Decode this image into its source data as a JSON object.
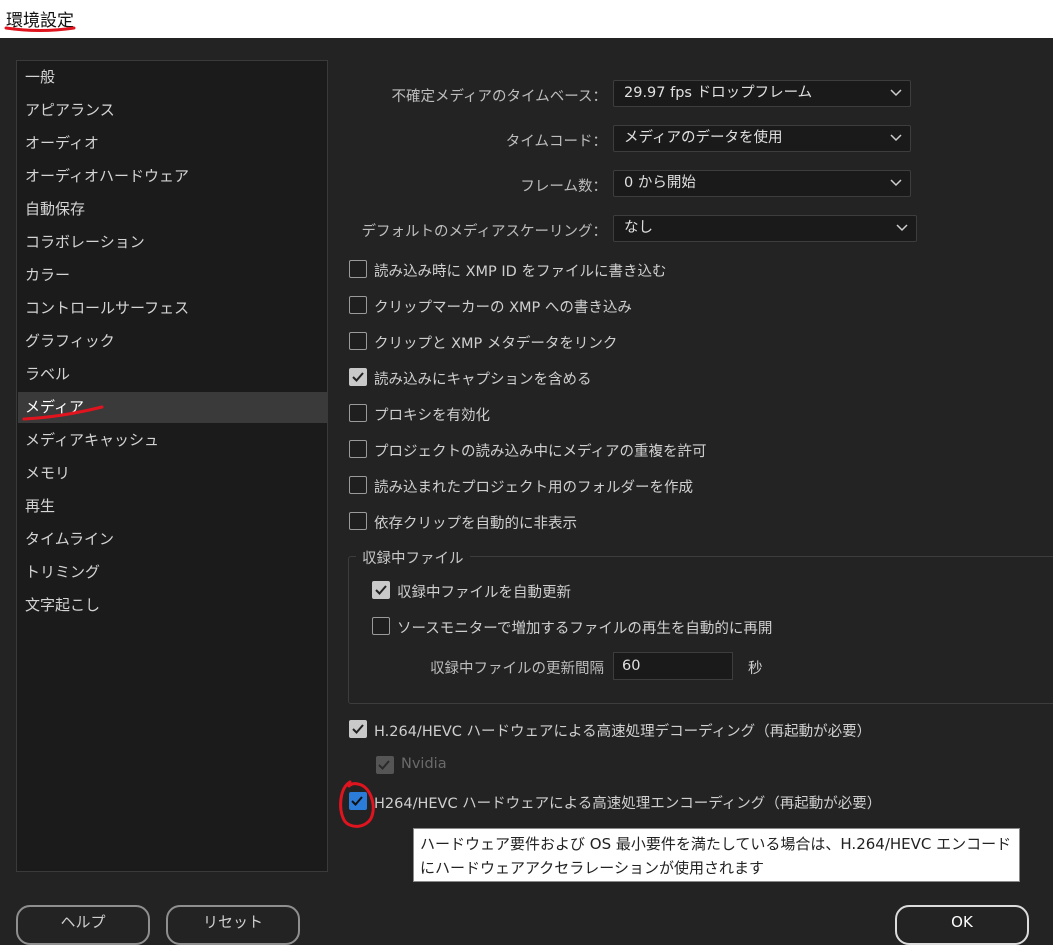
{
  "window": {
    "title": "環境設定"
  },
  "sidebar": {
    "items": [
      {
        "label": "一般"
      },
      {
        "label": "アピアランス"
      },
      {
        "label": "オーディオ"
      },
      {
        "label": "オーディオハードウェア"
      },
      {
        "label": "自動保存"
      },
      {
        "label": "コラボレーション"
      },
      {
        "label": "カラー"
      },
      {
        "label": "コントロールサーフェス"
      },
      {
        "label": "グラフィック"
      },
      {
        "label": "ラベル"
      },
      {
        "label": "メディア",
        "selected": true
      },
      {
        "label": "メディアキャッシュ"
      },
      {
        "label": "メモリ"
      },
      {
        "label": "再生"
      },
      {
        "label": "タイムライン"
      },
      {
        "label": "トリミング"
      },
      {
        "label": "文字起こし"
      }
    ]
  },
  "media": {
    "timebase": {
      "label": "不確定メディアのタイムベース：",
      "value": "29.97  fps  ドロップフレーム"
    },
    "timecode": {
      "label": "タイムコード：",
      "value": "メディアのデータを使用"
    },
    "framecount": {
      "label": "フレーム数：",
      "value": "0 から開始"
    },
    "scaling": {
      "label": "デフォルトのメディアスケーリング：",
      "value": "なし"
    },
    "checkboxes": [
      {
        "label": "読み込み時に XMP ID をファイルに書き込む",
        "checked": false
      },
      {
        "label": "クリップマーカーの XMP への書き込み",
        "checked": false
      },
      {
        "label": "クリップと XMP メタデータをリンク",
        "checked": false
      },
      {
        "label": "読み込みにキャプションを含める",
        "checked": true
      },
      {
        "label": "プロキシを有効化",
        "checked": false
      },
      {
        "label": "プロジェクトの読み込み中にメディアの重複を許可",
        "checked": false
      },
      {
        "label": "読み込まれたプロジェクト用のフォルダーを作成",
        "checked": false
      },
      {
        "label": "依存クリップを自動的に非表示",
        "checked": false
      }
    ],
    "growing": {
      "title": "収録中ファイル",
      "auto_refresh": {
        "label": "収録中ファイルを自動更新",
        "checked": true
      },
      "auto_resume": {
        "label": "ソースモニターで増加するファイルの再生を自動的に再開",
        "checked": false
      },
      "interval_label": "収録中ファイルの更新間隔",
      "interval_value": "60",
      "interval_unit": "秒"
    },
    "decode": {
      "label": "H.264/HEVC ハードウェアによる高速処理デコーディング（再起動が必要）",
      "checked": true
    },
    "nvidia": {
      "label": "Nvidia",
      "checked": true,
      "disabled": true
    },
    "encode": {
      "label": "H264/HEVC ハードウェアによる高速処理エンコーディング（再起動が必要）",
      "checked": true
    }
  },
  "tooltip": {
    "line1": "ハードウェア要件および OS 最小要件を満たしている場合は、H.264/HEVC エンコード",
    "line2": "にハードウェアアクセラレーションが使用されます"
  },
  "buttons": {
    "help": "ヘルプ",
    "reset": "リセット",
    "ok": "OK"
  },
  "colors": {
    "annotation_red": "#e0141e",
    "accent_blue": "#2b7bd9"
  }
}
